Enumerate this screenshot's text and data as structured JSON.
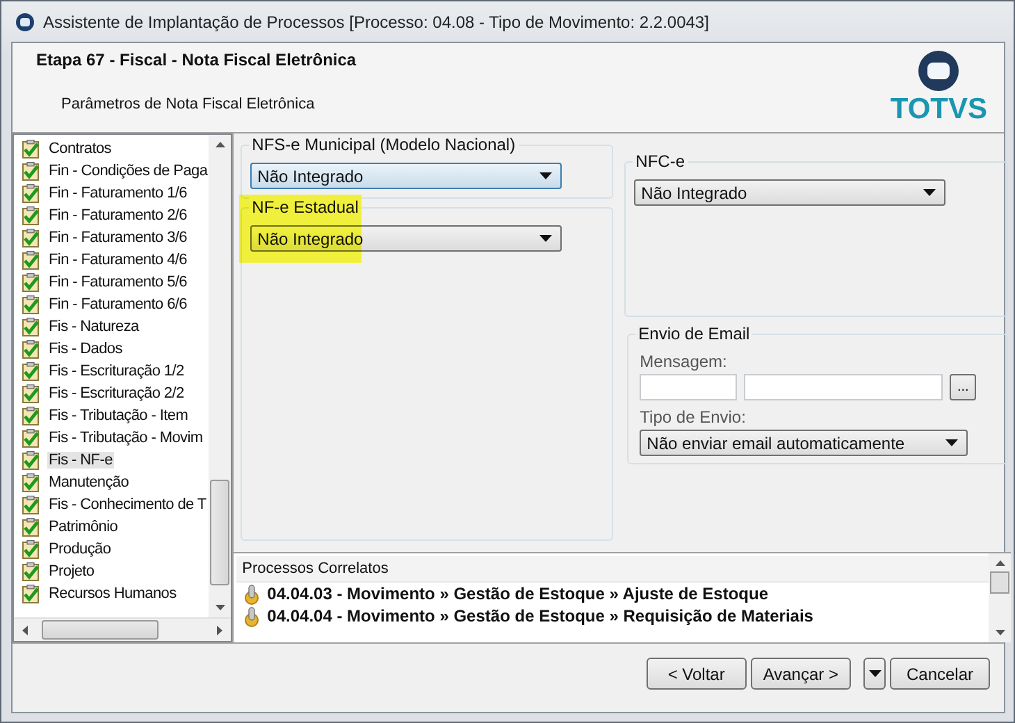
{
  "window": {
    "title": "Assistente de Implantação de Processos [Processo: 04.08 - Tipo de Movimento: 2.2.0043]"
  },
  "header": {
    "step_title": "Etapa 67 - Fiscal - Nota Fiscal Eletrônica",
    "subtitle": "Parâmetros de Nota Fiscal Eletrônica",
    "logo_text": "TOTVS"
  },
  "steps": [
    {
      "label": "Contratos",
      "checked": true,
      "selected": false
    },
    {
      "label": "Fin - Condições de Paga",
      "checked": true,
      "selected": false
    },
    {
      "label": "Fin - Faturamento 1/6",
      "checked": true,
      "selected": false
    },
    {
      "label": "Fin - Faturamento 2/6",
      "checked": true,
      "selected": false
    },
    {
      "label": "Fin - Faturamento 3/6",
      "checked": true,
      "selected": false
    },
    {
      "label": "Fin - Faturamento 4/6",
      "checked": true,
      "selected": false
    },
    {
      "label": "Fin - Faturamento 5/6",
      "checked": true,
      "selected": false
    },
    {
      "label": "Fin - Faturamento 6/6",
      "checked": true,
      "selected": false
    },
    {
      "label": "Fis - Natureza",
      "checked": true,
      "selected": false
    },
    {
      "label": "Fis - Dados",
      "checked": true,
      "selected": false
    },
    {
      "label": "Fis - Escrituração 1/2",
      "checked": true,
      "selected": false
    },
    {
      "label": "Fis - Escrituração 2/2",
      "checked": true,
      "selected": false
    },
    {
      "label": "Fis - Tributação - Item",
      "checked": true,
      "selected": false
    },
    {
      "label": "Fis - Tributação - Movim",
      "checked": true,
      "selected": false
    },
    {
      "label": "Fis - NF-e",
      "checked": true,
      "selected": true
    },
    {
      "label": "Manutenção",
      "checked": true,
      "selected": false
    },
    {
      "label": "Fis - Conhecimento de T",
      "checked": true,
      "selected": false
    },
    {
      "label": "Patrimônio",
      "checked": true,
      "selected": false
    },
    {
      "label": "Produção",
      "checked": true,
      "selected": false
    },
    {
      "label": "Projeto",
      "checked": true,
      "selected": false
    },
    {
      "label": "Recursos Humanos",
      "checked": true,
      "selected": false
    }
  ],
  "groups": [
    {
      "title": "NFS-e Municipal (Modelo Nacional)",
      "value": "Não Integrado",
      "highlighted": false
    },
    {
      "title": "NF-e Estadual",
      "value": "Não Integrado",
      "highlighted": true
    },
    {
      "title": "NFC-e",
      "value": "Não Integrado",
      "highlighted": false
    }
  ],
  "email": {
    "title": "Envio de Email",
    "message_label": "Mensagem:",
    "browse_button": "...",
    "send_type_label": "Tipo de Envio:",
    "send_type": "Não enviar email automaticamente"
  },
  "related": {
    "title": "Processos Correlatos",
    "items": [
      "04.04.03 - Movimento » Gestão de Estoque » Ajuste de Estoque",
      "04.04.04 - Movimento » Gestão de Estoque » Requisição de Materiais"
    ]
  },
  "buttons": {
    "back": "< Voltar",
    "next": "Avançar >",
    "cancel": "Cancelar"
  }
}
